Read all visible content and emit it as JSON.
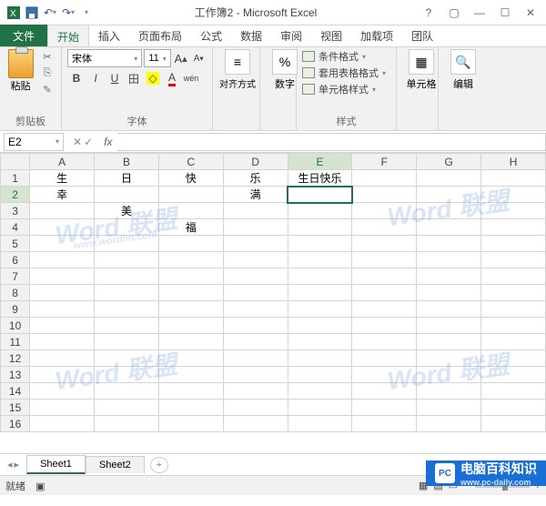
{
  "title": "工作簿2 - Microsoft Excel",
  "tabs": {
    "file": "文件",
    "items": [
      "开始",
      "插入",
      "页面布局",
      "公式",
      "数据",
      "审阅",
      "视图",
      "加载项",
      "团队"
    ],
    "active": 0
  },
  "ribbon": {
    "clipboard": {
      "paste": "粘贴",
      "label": "剪贴板"
    },
    "font": {
      "name": "宋体",
      "size": "11",
      "label": "字体",
      "bold": "B",
      "italic": "I",
      "underline": "U",
      "border": "田",
      "fill": "◇",
      "color": "A",
      "grow": "A",
      "shrink": "A",
      "phonetic": "wén"
    },
    "align": {
      "label": "对齐方式"
    },
    "number": {
      "label": "数字",
      "symbol": "%"
    },
    "styles": {
      "cond": "条件格式",
      "table": "套用表格格式",
      "cell": "单元格样式",
      "label": "样式"
    },
    "cells": {
      "label": "单元格"
    },
    "editing": {
      "label": "编辑"
    }
  },
  "namebox": "E2",
  "formula": "",
  "columns": [
    "A",
    "B",
    "C",
    "D",
    "E",
    "F",
    "G",
    "H"
  ],
  "rows": [
    "1",
    "2",
    "3",
    "4",
    "5",
    "6",
    "7",
    "8",
    "9",
    "10",
    "11",
    "12",
    "13",
    "14",
    "15",
    "16"
  ],
  "cells": {
    "A1": "生",
    "B1": "日",
    "C1": "快",
    "D1": "乐",
    "E1": "生日快乐",
    "A2": "幸",
    "D2": "满",
    "B3": "美",
    "C4": "福"
  },
  "selected": {
    "col": "E",
    "row": "2"
  },
  "sheets": {
    "items": [
      "Sheet1",
      "Sheet2"
    ],
    "active": 0
  },
  "status": {
    "ready": "就绪"
  },
  "watermark": "Word 联盟",
  "watermark_sub": "www.wordlm.com",
  "brand": {
    "logo": "PC",
    "text": "电脑百科知识",
    "url": "www.pc-daily.com"
  }
}
